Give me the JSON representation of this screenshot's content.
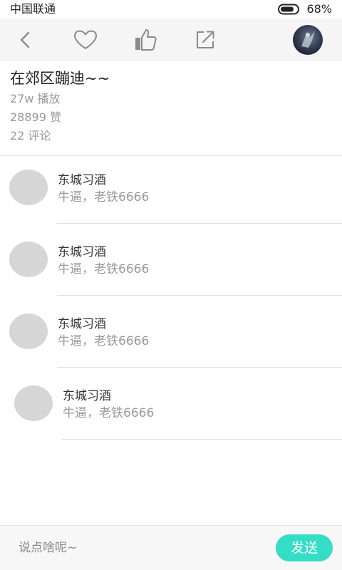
{
  "status_bar": {
    "carrier": "中国联通",
    "battery_percent": "68%",
    "battery_level": 0.68
  },
  "toolbar": {
    "icons": [
      "chevron-left-icon",
      "heart-icon",
      "thumbs-up-icon",
      "share-icon",
      "user-avatar"
    ]
  },
  "post": {
    "title": "在郊区蹦迪~~",
    "plays": "27w 播放",
    "likes": "28899 赞",
    "comments_count": "22 评论"
  },
  "comments": [
    {
      "name": "东城习酒",
      "text": "牛逼，老铁6666"
    },
    {
      "name": "东城习酒",
      "text": "牛逼，老铁6666"
    },
    {
      "name": "东城习酒",
      "text": "牛逼，老铁6666"
    },
    {
      "name": "东城习酒",
      "text": "牛逼，老铁6666"
    }
  ],
  "input_bar": {
    "placeholder": "说点啥呢~",
    "send_label": "发送"
  },
  "colors": {
    "accent": "#35dcc6",
    "toolbar_bg": "#f5f5f5",
    "icon_gray": "#8a8a8a"
  }
}
